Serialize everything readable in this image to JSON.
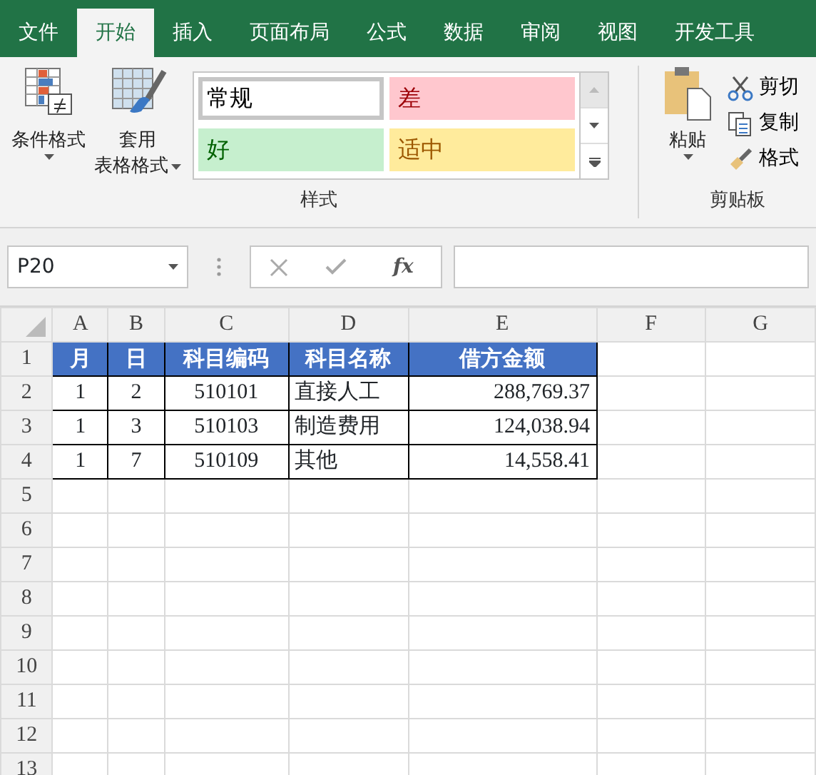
{
  "tabs": [
    {
      "label": "文件",
      "selected": false
    },
    {
      "label": "开始",
      "selected": true
    },
    {
      "label": "插入",
      "selected": false
    },
    {
      "label": "页面布局",
      "selected": false
    },
    {
      "label": "公式",
      "selected": false
    },
    {
      "label": "数据",
      "selected": false
    },
    {
      "label": "审阅",
      "selected": false
    },
    {
      "label": "视图",
      "selected": false
    },
    {
      "label": "开发工具",
      "selected": false
    }
  ],
  "ribbon": {
    "styles_group": {
      "conditional_formatting": {
        "label": "条件格式"
      },
      "format_as_table": {
        "label": "套用",
        "label_2": "表格格式"
      },
      "cell_styles": [
        {
          "label": "常规",
          "selected": true,
          "color": "#ffffff",
          "kind": "normal"
        },
        {
          "label": "差",
          "selected": false,
          "color": "#ffc7ce",
          "kind": "bad"
        },
        {
          "label": "好",
          "selected": false,
          "color": "#c6efce",
          "kind": "good"
        },
        {
          "label": "适中",
          "selected": false,
          "color": "#ffeb9c",
          "kind": "neutral"
        }
      ],
      "label": "样式"
    },
    "clipboard_group": {
      "paste": {
        "label": "粘贴"
      },
      "actions": [
        {
          "label": "剪切",
          "kind": "cut"
        },
        {
          "label": "复制",
          "kind": "copy"
        },
        {
          "label": "格式",
          "kind": "brush"
        }
      ],
      "label": "剪贴板"
    }
  },
  "formula_bar": {
    "name_box": "P20",
    "fx": "fx"
  },
  "sheet": {
    "columns": [
      "A",
      "B",
      "C",
      "D",
      "E",
      "F",
      "G"
    ],
    "row_numbers": [
      "1",
      "2",
      "3",
      "4",
      "5",
      "6",
      "7",
      "8",
      "9",
      "10",
      "11",
      "12",
      "13"
    ],
    "header_row": [
      "月",
      "日",
      "科目编码",
      "科目名称",
      "借方金额"
    ],
    "rows": [
      [
        "1",
        "2",
        "510101",
        "直接人工",
        "288,769.37"
      ],
      [
        "1",
        "3",
        "510103",
        "制造费用",
        "124,038.94"
      ],
      [
        "1",
        "7",
        "510109",
        "其他",
        "14,558.41"
      ]
    ]
  }
}
